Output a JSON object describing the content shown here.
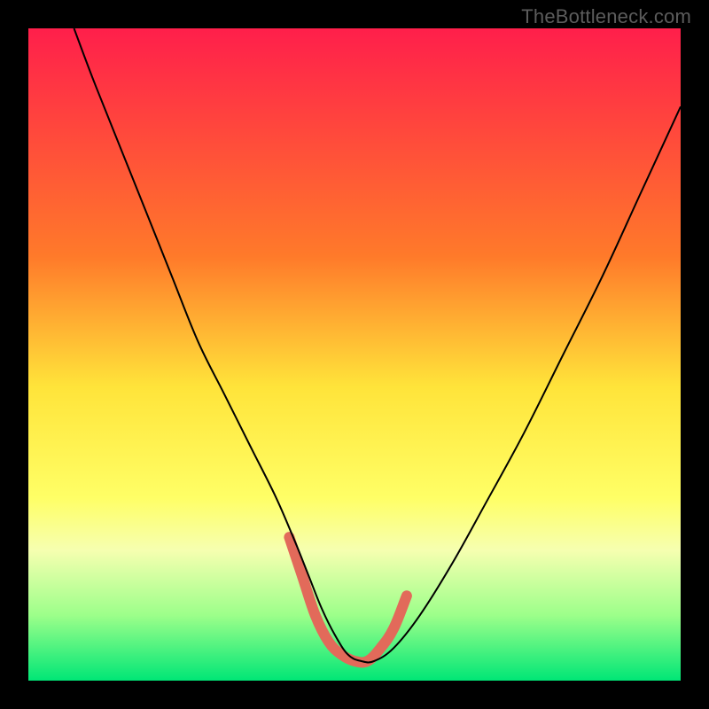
{
  "watermark": "TheBottleneck.com",
  "chart_data": {
    "type": "line",
    "title": "",
    "xlabel": "",
    "ylabel": "",
    "xlim": [
      0,
      100
    ],
    "ylim": [
      0,
      100
    ],
    "gradient_stops": [
      {
        "offset": 0,
        "color": "#ff1f4b"
      },
      {
        "offset": 35,
        "color": "#ff7a2a"
      },
      {
        "offset": 55,
        "color": "#ffe43a"
      },
      {
        "offset": 72,
        "color": "#ffff66"
      },
      {
        "offset": 80,
        "color": "#f6ffb0"
      },
      {
        "offset": 90,
        "color": "#9cff8a"
      },
      {
        "offset": 100,
        "color": "#00e676"
      }
    ],
    "series": [
      {
        "name": "bottleneck-curve",
        "color": "#000000",
        "stroke_width": 2,
        "x": [
          7,
          10,
          14,
          18,
          22,
          26,
          30,
          34,
          38,
          41,
          43,
          45,
          47,
          49,
          51,
          53,
          56,
          60,
          65,
          70,
          76,
          82,
          88,
          94,
          100
        ],
        "y": [
          100,
          92,
          82,
          72,
          62,
          52,
          44,
          36,
          28,
          21,
          16,
          11,
          7,
          4,
          3,
          3,
          5,
          10,
          18,
          27,
          38,
          50,
          62,
          75,
          88
        ]
      },
      {
        "name": "highlight-trough",
        "color": "#e26a5a",
        "stroke_width": 12,
        "linecap": "round",
        "x": [
          40,
          42,
          44,
          46,
          48,
          50,
          52,
          54,
          56,
          58
        ],
        "y": [
          22,
          16,
          10,
          6,
          4,
          3,
          3,
          5,
          8,
          13
        ]
      }
    ]
  }
}
